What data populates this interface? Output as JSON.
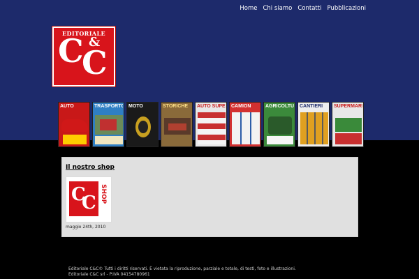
{
  "nav": {
    "items": [
      "Home",
      "Chi siamo",
      "Contatti",
      "Pubblicazioni"
    ]
  },
  "logo": {
    "top_text": "EDITORIALE",
    "mark_c1": "C",
    "mark_amp": "&",
    "mark_c2": "C"
  },
  "magazines": [
    {
      "title": "AUTO",
      "bg": "#c81818",
      "fg": "#ffffff"
    },
    {
      "title": "TRASPORTO",
      "bg": "#2f7fc4",
      "fg": "#ffffff"
    },
    {
      "title": "MOTO",
      "bg": "#1a1a1a",
      "fg": "#ffffff"
    },
    {
      "title": "STORICHE",
      "bg": "#8a6a3a",
      "fg": "#ffe28a"
    },
    {
      "title": "AUTO SUPERMARKET",
      "bg": "#e8e8e8",
      "fg": "#c81818"
    },
    {
      "title": "CAMION",
      "bg": "#d23030",
      "fg": "#ffffff"
    },
    {
      "title": "AGRICOLTURA",
      "bg": "#3b8a3b",
      "fg": "#ffffff"
    },
    {
      "title": "CANTIERI",
      "bg": "#eeeeee",
      "fg": "#1d2a6b"
    },
    {
      "title": "SUPERMARKET",
      "bg": "#e8e8e8",
      "fg": "#c81818"
    }
  ],
  "content": {
    "shop_title": "Il nostro shop",
    "thumb": {
      "c1": "C",
      "c2": "C",
      "side": "SHOP"
    },
    "date": "maggio 24th, 2010"
  },
  "footer": {
    "line1": "Editoriale C&C© Tutti i diritti riservati. È vietata la riproduzione, parziale e totale, di testi, foto e illustrazioni.",
    "line2": "Editoriale C&C srl - P.IVA 04154780961"
  }
}
